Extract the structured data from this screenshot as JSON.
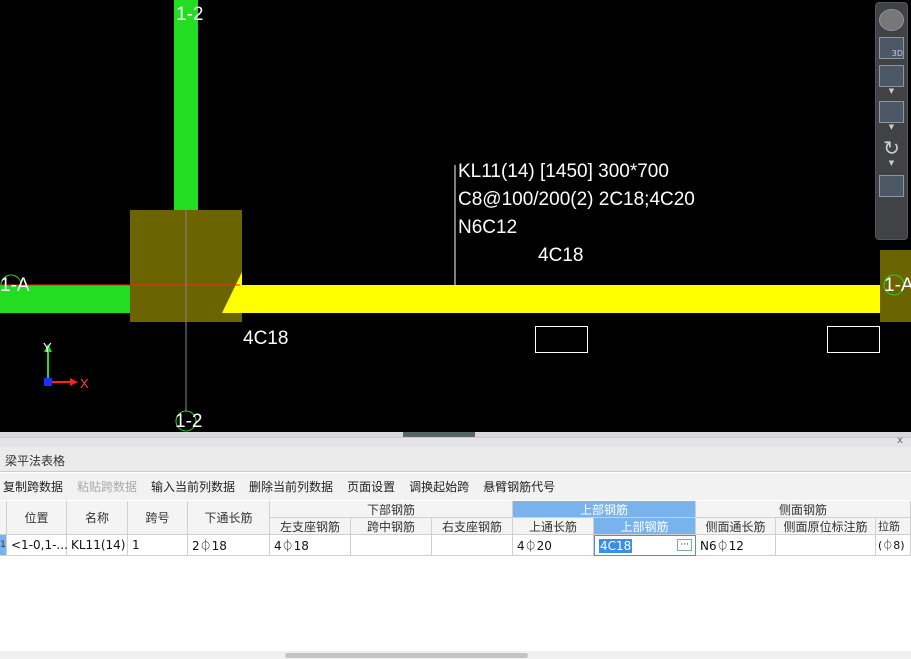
{
  "canvas": {
    "axis_labels": {
      "top_column": "1-2",
      "bottom_column": "1-2",
      "left_row": "1-A",
      "right_row": "1-A"
    },
    "beam_annotation": [
      "KL11(14) [1450] 300*700",
      "C8@100/200(2) 2C18;4C20",
      "N6C12"
    ],
    "top_rebar_label": "4C18",
    "left_support_label": "4C18",
    "coord_axes": {
      "y": "Y",
      "x": "X"
    },
    "colors": {
      "column": "#22dd22",
      "beam": "#ffff00",
      "support": "#6b6400",
      "background": "#000000"
    }
  },
  "view_toolbar": {
    "items": [
      "orbit-icon",
      "3d-view-icon",
      "view-cube-icon",
      "box-icon",
      "rotate-icon",
      "display-settings-icon"
    ],
    "label_3d": "3D"
  },
  "panel": {
    "close": "x",
    "title": "梁平法表格",
    "toolbar": [
      {
        "label": "复制跨数据",
        "enabled": true
      },
      {
        "label": "粘贴跨数据",
        "enabled": false
      },
      {
        "label": "输入当前列数据",
        "enabled": true
      },
      {
        "label": "删除当前列数据",
        "enabled": true
      },
      {
        "label": "页面设置",
        "enabled": true
      },
      {
        "label": "调换起始跨",
        "enabled": true
      },
      {
        "label": "悬臂钢筋代号",
        "enabled": true
      }
    ],
    "groups": {
      "bottom": "下部钢筋",
      "top": "上部钢筋",
      "side": "侧面钢筋"
    },
    "headers": [
      "位置",
      "名称",
      "跨号",
      "下通长筋",
      "左支座钢筋",
      "跨中钢筋",
      "右支座钢筋",
      "上通长筋",
      "上部钢筋",
      "侧面通长筋",
      "侧面原位标注筋",
      "拉筋"
    ],
    "row_number": "1",
    "row": [
      "<1-0,1-...",
      "KL11(14)",
      "1",
      "2⏀18",
      "4⏀18",
      "",
      "",
      "4⏀20",
      "4C18",
      "N6⏀12",
      "",
      "(⏀8)"
    ],
    "editing_button": "···"
  }
}
